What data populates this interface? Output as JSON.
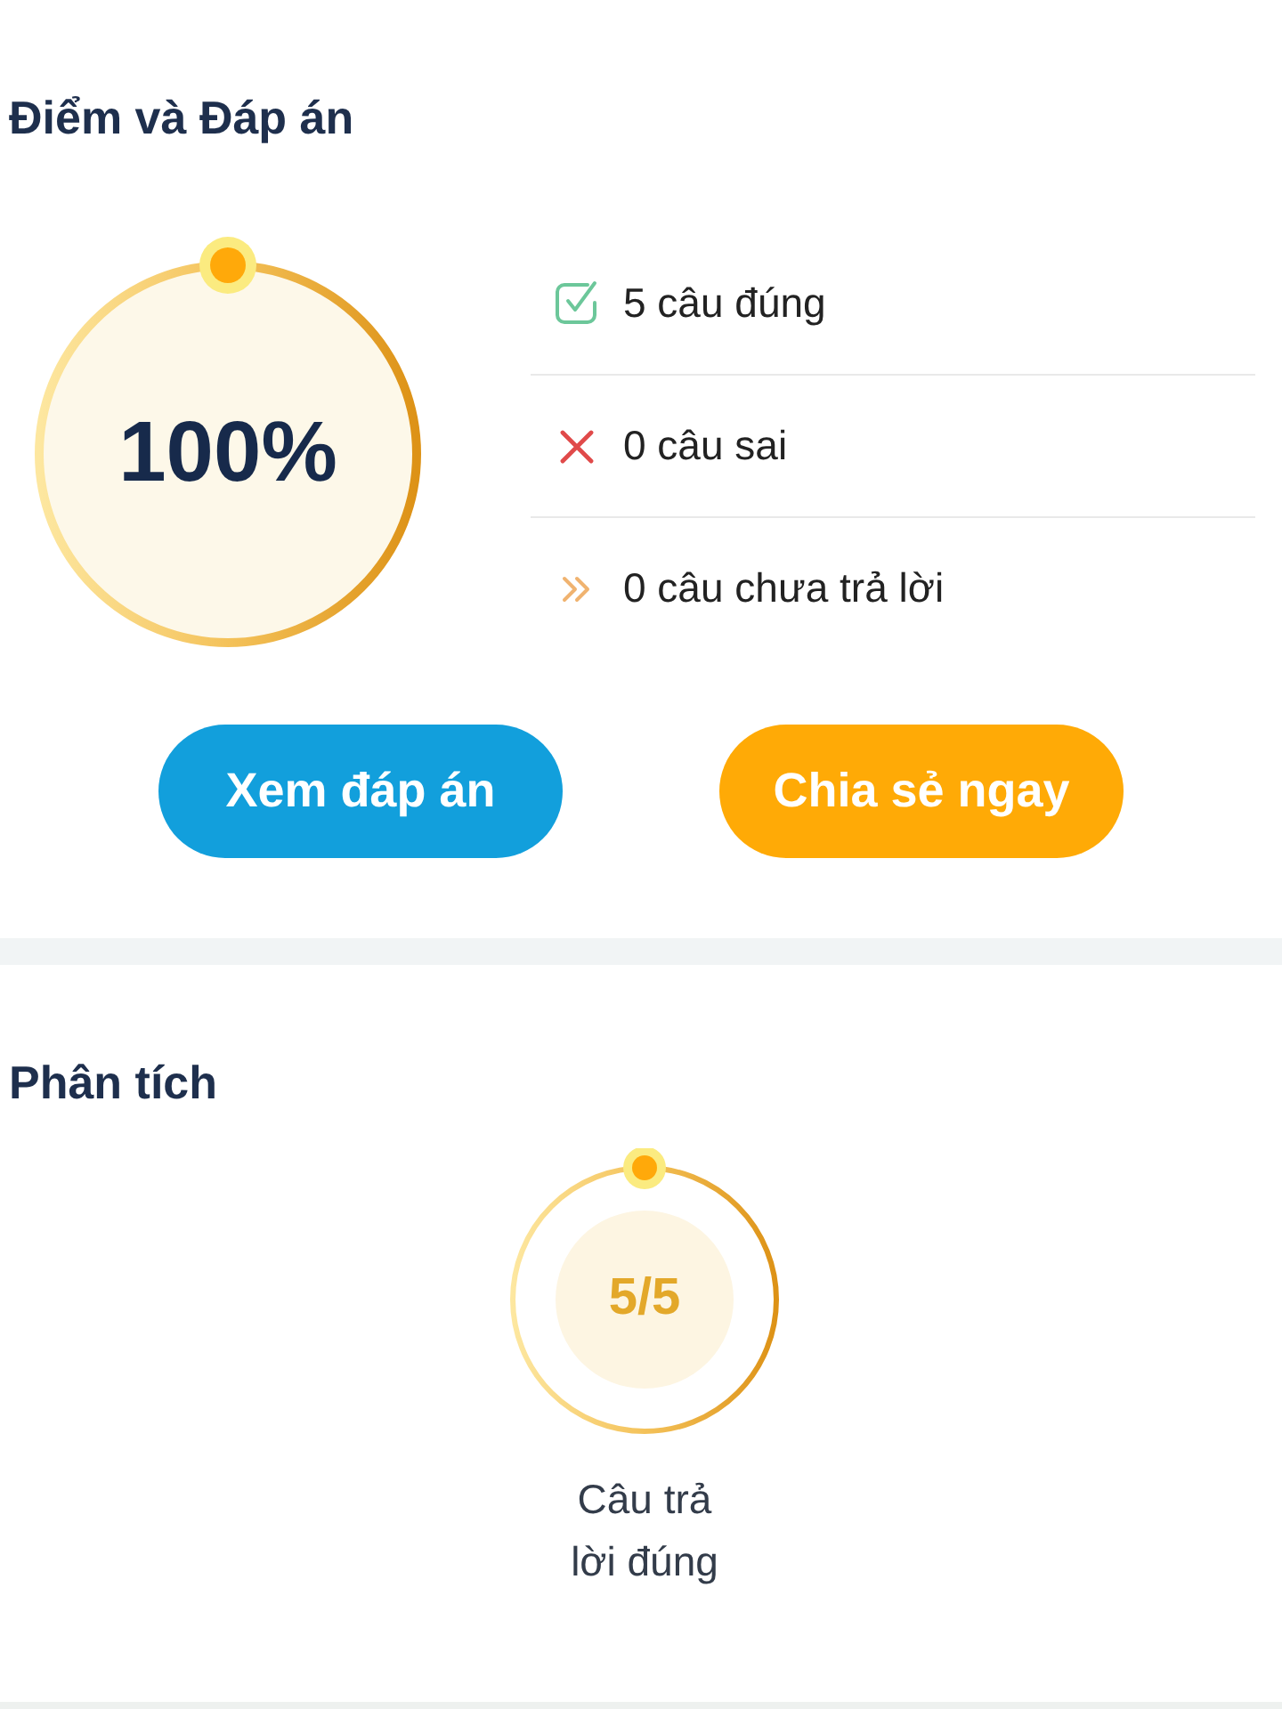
{
  "score": {
    "title": "Điểm và Đáp án",
    "percent": "100%",
    "level": 1
  },
  "results": [
    {
      "kind": "correct",
      "label": "5 câu đúng"
    },
    {
      "kind": "wrong",
      "label": "0 câu sai"
    },
    {
      "kind": "unanswered",
      "label": "0 câu chưa trả lời"
    }
  ],
  "buttons": [
    {
      "kind": "primary",
      "label": "Xem đáp án"
    },
    {
      "kind": "secondary",
      "label": "Chia sẻ ngay"
    }
  ],
  "analysis": {
    "title": "Phân tích",
    "metrics": [
      {
        "value": "5/5",
        "label": "Câu trả lời đúng",
        "level": 1
      }
    ]
  }
}
